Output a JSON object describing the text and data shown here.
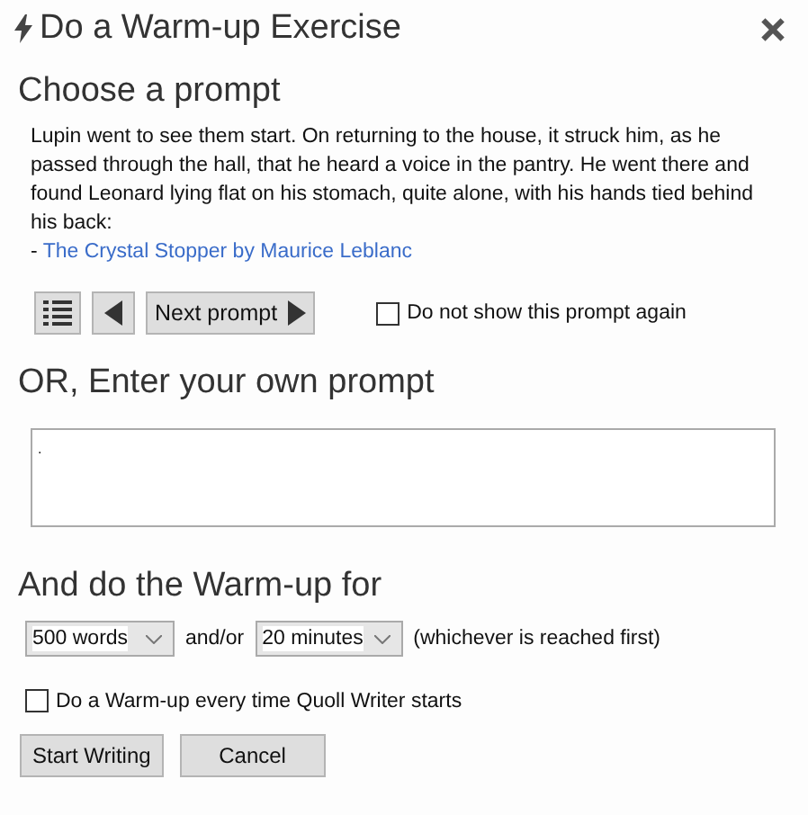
{
  "window": {
    "title": "Do a Warm-up Exercise"
  },
  "prompt_section": {
    "heading": "Choose a prompt",
    "text": "Lupin went to see them start. On returning to the house, it struck him, as he passed through the hall, that he heard a voice in the pantry. He went there and found Leonard lying flat on his stomach, quite alone, with his hands tied behind his back:",
    "source_prefix": "-",
    "source_link": "The Crystal Stopper by Maurice Leblanc",
    "next_button": "Next prompt",
    "dont_show": {
      "label": "Do not show this prompt again",
      "checked": false
    }
  },
  "own_prompt": {
    "heading": "OR, Enter your own prompt",
    "value": "."
  },
  "duration": {
    "heading": "And do the Warm-up for",
    "words": "500 words",
    "joiner": "and/or",
    "minutes": "20 minutes",
    "note": "(whichever is reached first)"
  },
  "every_time": {
    "label": "Do a Warm-up every time Quoll Writer starts",
    "checked": false
  },
  "buttons": [
    "Start Writing",
    "Cancel"
  ]
}
